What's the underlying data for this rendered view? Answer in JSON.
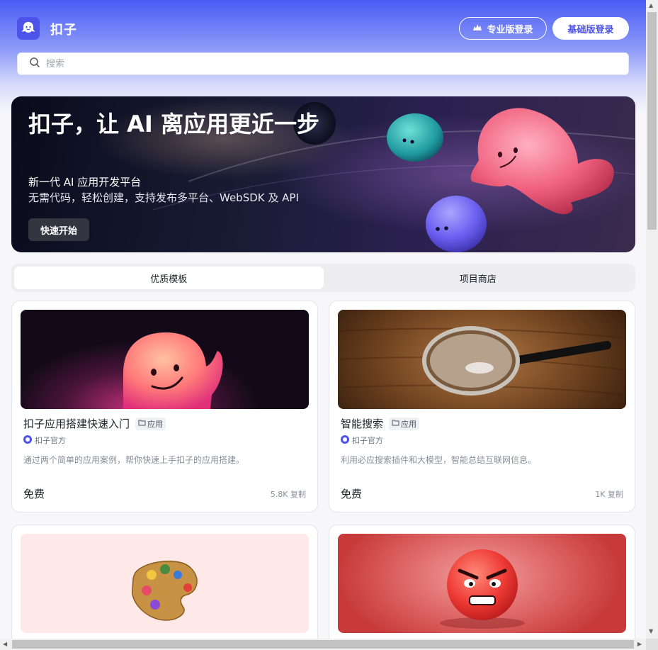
{
  "header": {
    "brand": "扣子",
    "pro_login": "专业版登录",
    "basic_login": "基础版登录"
  },
  "search": {
    "placeholder": "搜索"
  },
  "hero": {
    "title": "扣子，让 AI 离应用更近一步",
    "subtitle1": "新一代 AI 应用开发平台",
    "subtitle2": "无需代码，轻松创建，支持发布多平台、WebSDK 及 API",
    "cta": "快速开始"
  },
  "tabs": [
    {
      "label": "优质模板",
      "active": true
    },
    {
      "label": "项目商店",
      "active": false
    }
  ],
  "cards": [
    {
      "title": "扣子应用搭建快速入门",
      "tag": "应用",
      "author": "扣子官方",
      "desc": "通过两个简单的应用案例，帮你快速上手扣子的应用搭建。",
      "price": "免费",
      "stats": "5.8K 复制"
    },
    {
      "title": "智能搜索",
      "tag": "应用",
      "author": "扣子官方",
      "desc": "利用必应搜索插件和大模型，智能总结互联网信息。",
      "price": "免费",
      "stats": "1K 复制"
    },
    {
      "title": "",
      "tag": "",
      "author": "",
      "desc": "",
      "price": "",
      "stats": ""
    },
    {
      "title": "",
      "tag": "",
      "author": "",
      "desc": "",
      "price": "",
      "stats": ""
    }
  ],
  "colors": {
    "accent": "#4d53e8",
    "header_top": "#4a5cf5"
  },
  "icons": [
    "coze-logo-icon",
    "pro-chart-icon",
    "search-icon",
    "folder-icon",
    "official-avatar-icon"
  ]
}
